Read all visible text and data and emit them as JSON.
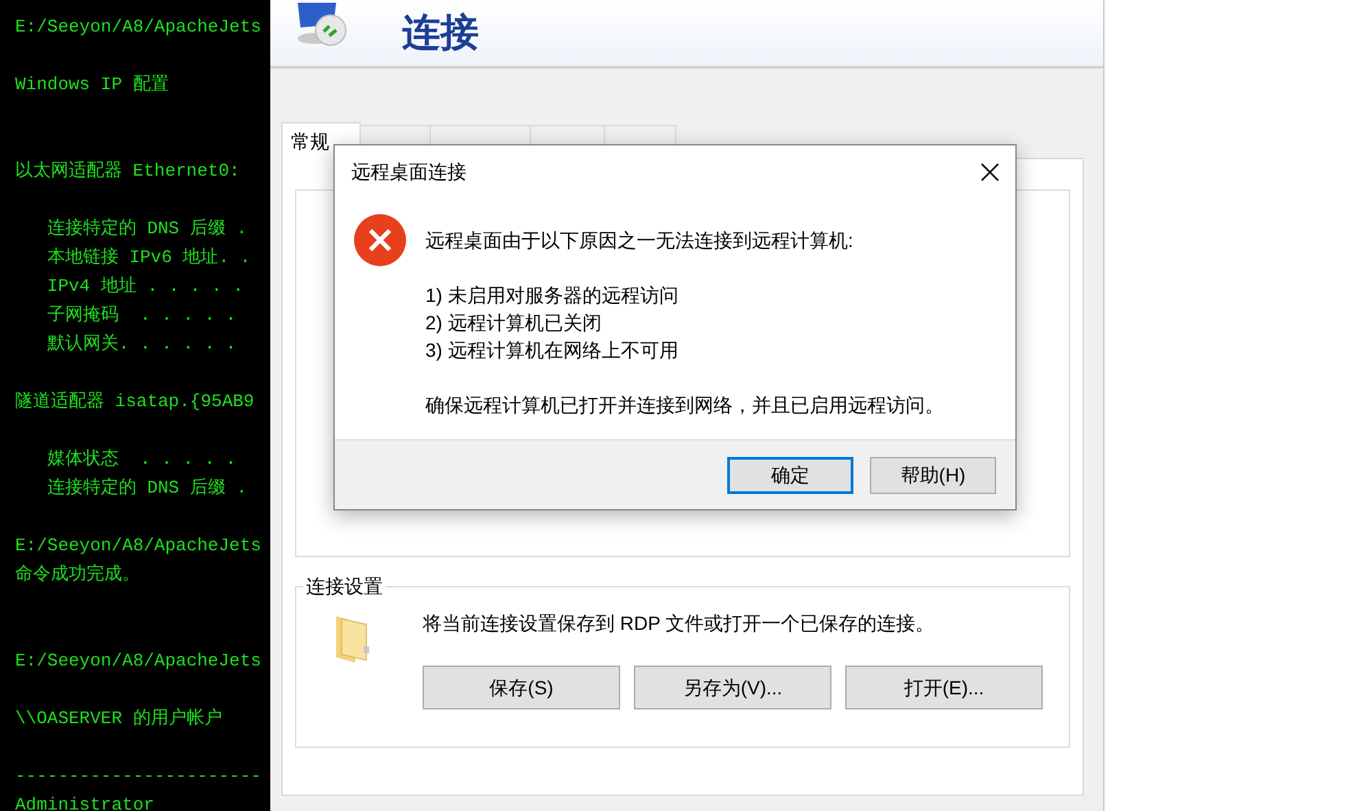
{
  "terminal": {
    "lines": [
      {
        "kind": "text",
        "text": "E:/Seeyon/A8/ApacheJets"
      },
      {
        "kind": "blank"
      },
      {
        "kind": "text",
        "text": "Windows IP 配置"
      },
      {
        "kind": "blank"
      },
      {
        "kind": "blank"
      },
      {
        "kind": "text",
        "text": "以太网适配器 Ethernet0:"
      },
      {
        "kind": "blank"
      },
      {
        "kind": "text",
        "text": "   连接特定的 DNS 后缀 ."
      },
      {
        "kind": "text",
        "text": "   本地链接 IPv6 地址. ."
      },
      {
        "kind": "text",
        "text": "   IPv4 地址 . . . . ."
      },
      {
        "kind": "text",
        "text": "   子网掩码  . . . . ."
      },
      {
        "kind": "text",
        "text": "   默认网关. . . . . ."
      },
      {
        "kind": "blank"
      },
      {
        "kind": "text",
        "text": "隧道适配器 isatap.{95AB9"
      },
      {
        "kind": "blank"
      },
      {
        "kind": "text",
        "text": "   媒体状态  . . . . ."
      },
      {
        "kind": "text",
        "text": "   连接特定的 DNS 后缀 ."
      },
      {
        "kind": "blank"
      },
      {
        "kind": "text",
        "text": "E:/Seeyon/A8/ApacheJets"
      },
      {
        "kind": "text",
        "text": "命令成功完成。"
      },
      {
        "kind": "blank"
      },
      {
        "kind": "blank"
      },
      {
        "kind": "text",
        "text": "E:/Seeyon/A8/ApacheJets"
      },
      {
        "kind": "blank"
      },
      {
        "kind": "text",
        "text": "\\\\OASERVER 的用户帐户"
      },
      {
        "kind": "blank"
      },
      {
        "kind": "text",
        "text": "-----------------------"
      },
      {
        "kind": "text",
        "text": "Administrator"
      }
    ]
  },
  "rdc_window": {
    "header_title": "连接",
    "tabs": [
      {
        "label": "常规",
        "selected": true
      },
      {
        "selected": false
      },
      {
        "selected": false
      },
      {
        "selected": false
      },
      {
        "selected": false
      }
    ],
    "connection_settings": {
      "title": "连接设置",
      "description": "将当前连接设置保存到 RDP 文件或打开一个已保存的连接。",
      "buttons": [
        "保存(S)",
        "另存为(V)...",
        "打开(E)..."
      ]
    }
  },
  "dialog": {
    "title": "远程桌面连接",
    "message": "远程桌面由于以下原因之一无法连接到远程计算机:",
    "reasons": [
      "1) 未启用对服务器的远程访问",
      "2) 远程计算机已关闭",
      "3) 远程计算机在网络上不可用"
    ],
    "advice": "确保远程计算机已打开并连接到网络，并且已启用远程访问。",
    "buttons": [
      {
        "label": "确定",
        "selected": true
      },
      {
        "label": "帮助(H)",
        "selected": false
      }
    ]
  }
}
